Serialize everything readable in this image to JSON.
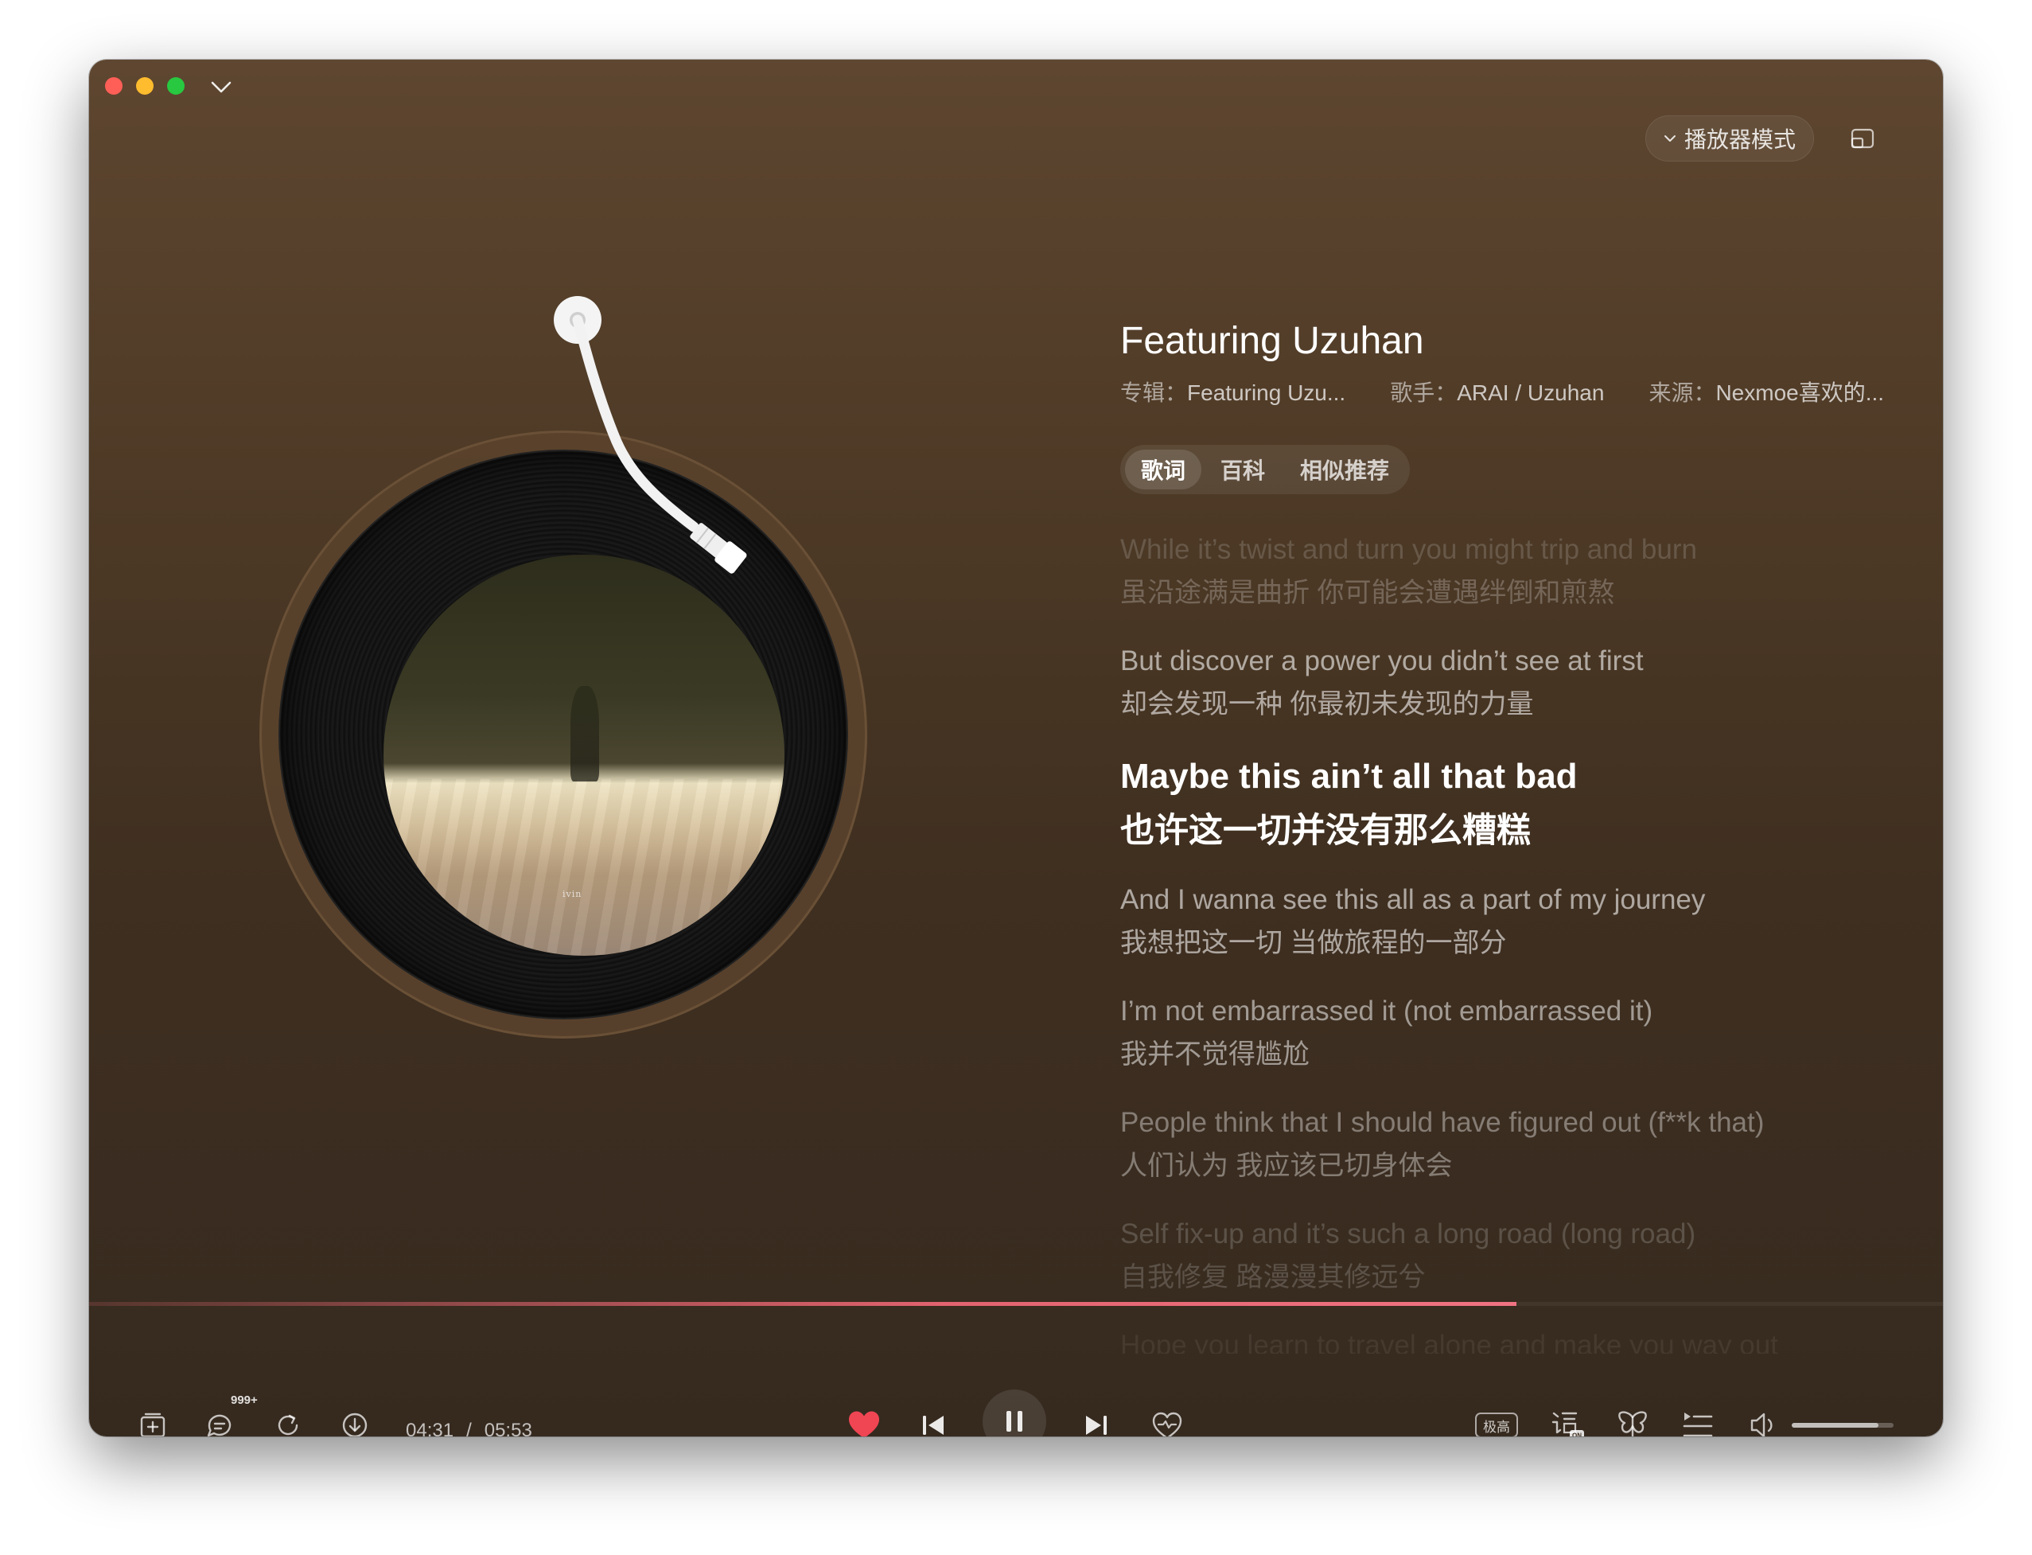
{
  "window": {
    "mode_button": "播放器模式"
  },
  "song": {
    "title": "Featuring Uzuhan",
    "album_label": "专辑：",
    "album": "Featuring Uzu...",
    "artist_label": "歌手：",
    "artist": "ARAI / Uzuhan",
    "source_label": "来源：",
    "source": "Nexmoe喜欢的...",
    "cover_text": "ivin"
  },
  "tabs": [
    {
      "label": "歌词",
      "active": true
    },
    {
      "label": "百科",
      "active": false
    },
    {
      "label": "相似推荐",
      "active": false
    }
  ],
  "lyrics": [
    {
      "en": "While it’s twist and turn you might trip and burn",
      "zh": "虽沿途满是曲折 你可能会遭遇绊倒和煎熬",
      "state": "faded"
    },
    {
      "en": "But discover a power you didn’t see at first",
      "zh": "却会发现一种 你最初未发现的力量",
      "state": "normal"
    },
    {
      "en": "Maybe this ain’t all that bad",
      "zh": "也许这一切并没有那么糟糕",
      "state": "active"
    },
    {
      "en": "And I wanna see this all as a part of my journey",
      "zh": "我想把这一切 当做旅程的一部分",
      "state": "normal"
    },
    {
      "en": "I’m not embarrassed it (not embarrassed it)",
      "zh": "我并不觉得尴尬",
      "state": "normal"
    },
    {
      "en": "People think that I should have figured out (f**k that)",
      "zh": "人们认为 我应该已切身体会",
      "state": "dim"
    },
    {
      "en": "Self fix-up and it’s such a long road (long road)",
      "zh": "自我修复 路漫漫其修远兮",
      "state": "faded"
    },
    {
      "en": "Hope you learn to travel alone and make you way out",
      "zh": "",
      "state": "ghost"
    }
  ],
  "player": {
    "current_time": "04:31",
    "separator": "/",
    "total_time": "05:53",
    "progress": 0.77,
    "comment_count": "999+",
    "quality_label": "极高",
    "liked": true,
    "is_playing": true,
    "volume": 0.85
  },
  "colors": {
    "accent": "#e2636f",
    "like": "#f04553",
    "background": "#4e3a26"
  }
}
